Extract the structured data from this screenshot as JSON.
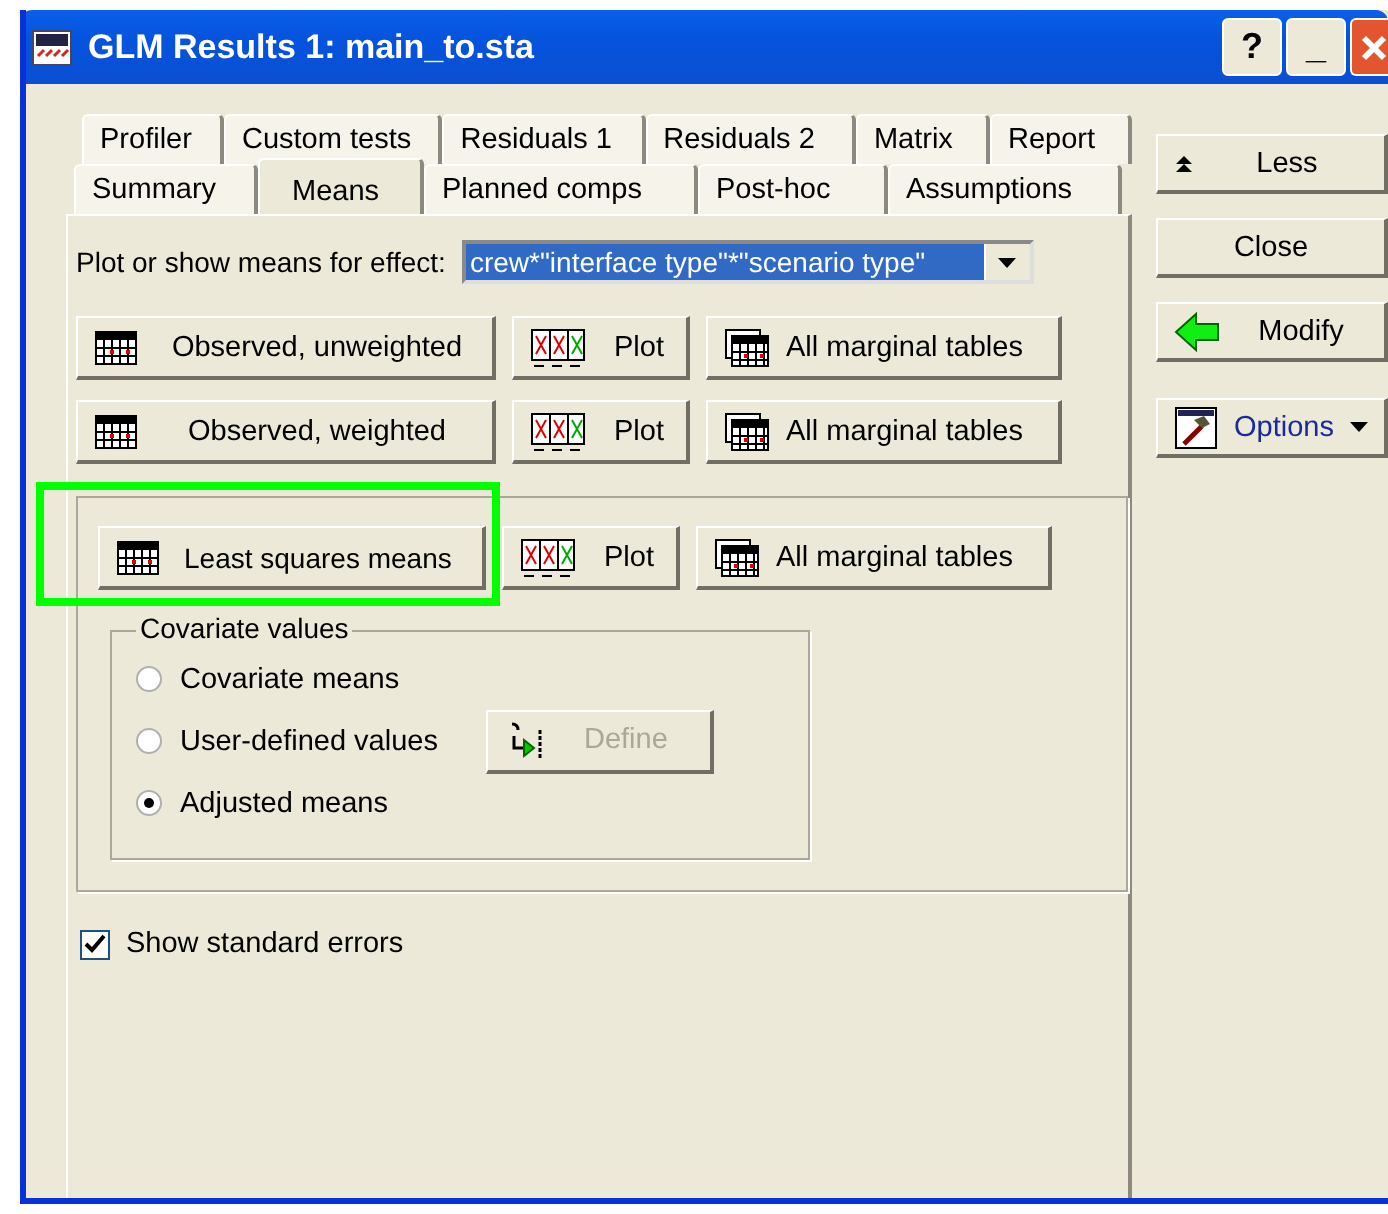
{
  "window": {
    "title": "GLM Results 1: main_to.sta",
    "title_buttons": [
      "?",
      "_"
    ]
  },
  "tab_rows": [
    {
      "tabs": [
        {
          "label": "Profiler",
          "selected": false
        },
        {
          "label": "Custom tests",
          "selected": false
        },
        {
          "label": "Residuals 1",
          "selected": false
        },
        {
          "label": "Residuals 2",
          "selected": false
        },
        {
          "label": "Matrix",
          "selected": false
        },
        {
          "label": "Report",
          "selected": false
        }
      ]
    },
    {
      "tabs": [
        {
          "label": "Summary",
          "selected": false
        },
        {
          "label": "Means",
          "selected": true
        },
        {
          "label": "Planned comps",
          "selected": false
        },
        {
          "label": "Post-hoc",
          "selected": false
        },
        {
          "label": "Assumptions",
          "selected": false
        }
      ]
    }
  ],
  "effect": {
    "label": "Plot or show means for effect:",
    "value": "crew*\"interface type\"*\"scenario type\""
  },
  "button_rows": [
    {
      "buttons": [
        {
          "kind": "table",
          "label": "Observed, unweighted"
        },
        {
          "kind": "plot",
          "label": "Plot"
        },
        {
          "kind": "tables",
          "label": "All marginal tables"
        }
      ]
    },
    {
      "buttons": [
        {
          "kind": "table",
          "label": "Observed, weighted"
        },
        {
          "kind": "plot",
          "label": "Plot"
        },
        {
          "kind": "tables",
          "label": "All marginal tables"
        }
      ]
    }
  ],
  "least_squares": {
    "highlighted": true,
    "buttons": [
      {
        "kind": "table",
        "label": "Least squares means"
      },
      {
        "kind": "plot",
        "label": "Plot"
      },
      {
        "kind": "tables",
        "label": "All marginal tables"
      }
    ],
    "covariate_group": {
      "title": "Covariate values",
      "options": [
        {
          "label": "Covariate means",
          "selected": false
        },
        {
          "label": "User-defined values",
          "selected": false
        },
        {
          "label": "Adjusted means",
          "selected": true
        }
      ],
      "define_button": {
        "label": "Define",
        "disabled": true
      }
    }
  },
  "show_standard_errors": {
    "label": "Show standard errors",
    "checked": true
  },
  "side_buttons": [
    {
      "kind": "less",
      "label": "Less"
    },
    {
      "kind": "plain",
      "label": "Close"
    },
    {
      "kind": "modify",
      "label": "Modify"
    },
    {
      "kind": "options",
      "label": "Options"
    }
  ]
}
